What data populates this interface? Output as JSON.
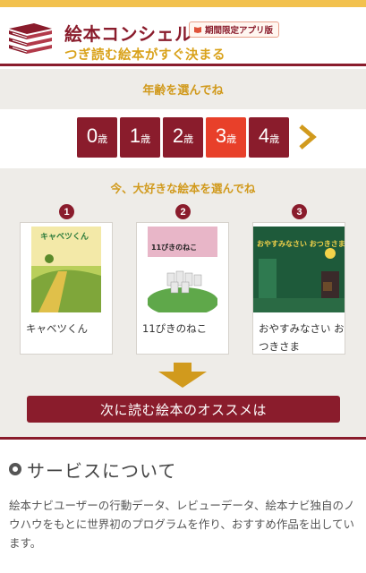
{
  "header": {
    "title": "絵本コンシェル",
    "badge": "期間限定アプリ版",
    "tagline": "つぎ読む絵本がすぐ決まる"
  },
  "age": {
    "heading": "年齢を選んでね",
    "unit": "歳",
    "options": [
      "0",
      "1",
      "2",
      "3",
      "4"
    ],
    "selected": "3"
  },
  "books": {
    "heading": "今、大好きな絵本を選んでね",
    "items": [
      {
        "rank": "1",
        "title": "キャベツくん",
        "cover_text": "キャベツくん"
      },
      {
        "rank": "2",
        "title": "11ぴきのねこ",
        "cover_text": "11ぴきのねこ"
      },
      {
        "rank": "3",
        "title": "おやすみなさい おつきさま",
        "cover_text": "おやすみなさい おつきさま"
      }
    ]
  },
  "cta": {
    "label": "次に読む絵本のオススメは"
  },
  "service": {
    "title": "サービスについて",
    "body": "絵本ナビユーザーの行動データ、レビューデータ、絵本ナビ独自のノウハウをもとに世界初のプログラムを作り、おすすめ作品を出しています。"
  },
  "colors": {
    "brand": "#8a1c2c",
    "accent_gold": "#d19a1d",
    "selected": "#e8402a",
    "panel_bg": "#eeece8"
  }
}
